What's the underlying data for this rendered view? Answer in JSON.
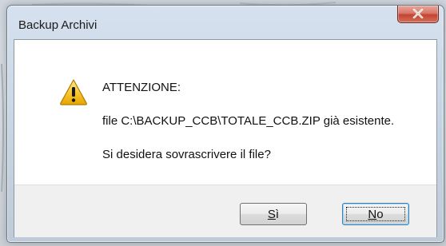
{
  "window": {
    "title": "Backup Archivi"
  },
  "message": {
    "icon": "warning-icon",
    "heading": "ATTENZIONE:",
    "line1": "file C:\\BACKUP_CCB\\TOTALE_CCB.ZIP già esistente.",
    "line2": "Si desidera sovrascrivere il file?"
  },
  "buttons": {
    "yes_accesskey": "S",
    "yes_rest": "ì",
    "no_accesskey": "N",
    "no_rest": "o",
    "default": "No"
  },
  "colors": {
    "close_button": "#c5442f",
    "client_background": "#ffffff",
    "button_bar": "#f0f0f0",
    "focus_border": "#3c7fb1"
  }
}
